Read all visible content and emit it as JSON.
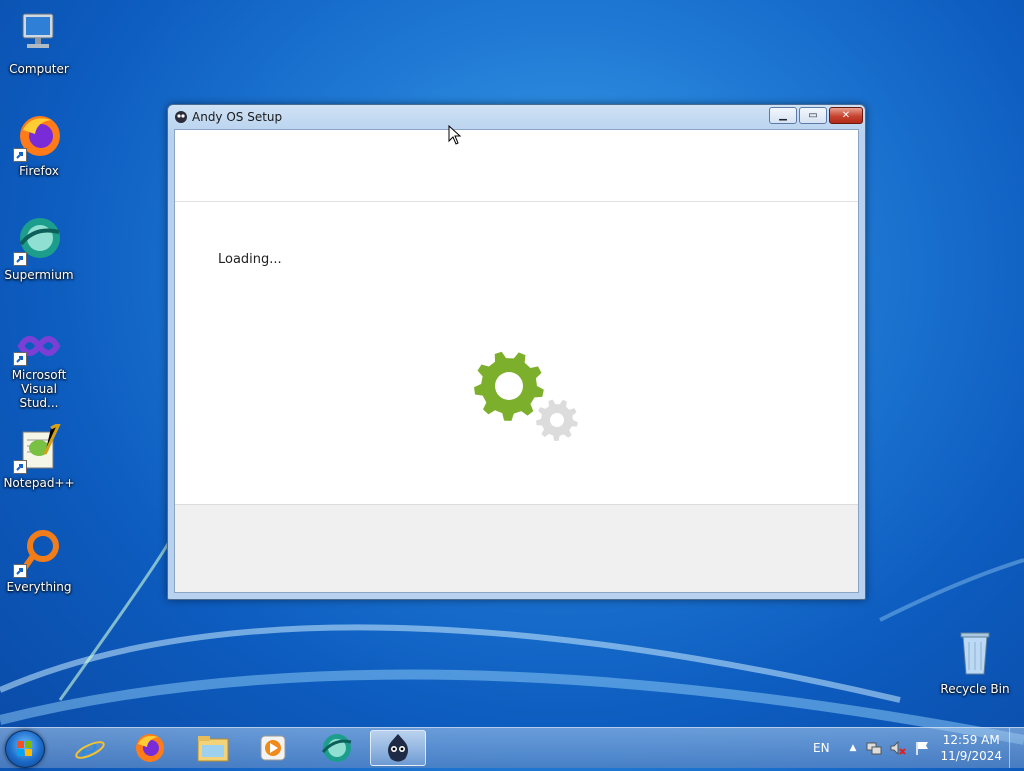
{
  "desktop": {
    "icons": [
      {
        "label": "Computer"
      },
      {
        "label": "Firefox"
      },
      {
        "label": "Supermium"
      },
      {
        "label": "Microsoft Visual Stud..."
      },
      {
        "label": "Notepad++"
      },
      {
        "label": "Everything"
      },
      {
        "label": "Recycle Bin"
      }
    ]
  },
  "window": {
    "title": "Andy OS Setup",
    "status_text": "Loading...",
    "gear_primary_color": "#7cb02c",
    "gear_secondary_color": "#dcdcdc"
  },
  "taskbar": {
    "pinned": [
      {
        "icon": "internet-explorer-icon"
      },
      {
        "icon": "firefox-icon"
      },
      {
        "icon": "file-explorer-icon"
      },
      {
        "icon": "media-player-icon"
      },
      {
        "icon": "supermium-icon"
      },
      {
        "icon": "andy-os-icon",
        "active": true
      }
    ],
    "tray": {
      "language": "EN",
      "time": "12:59 AM",
      "date": "11/9/2024"
    }
  }
}
